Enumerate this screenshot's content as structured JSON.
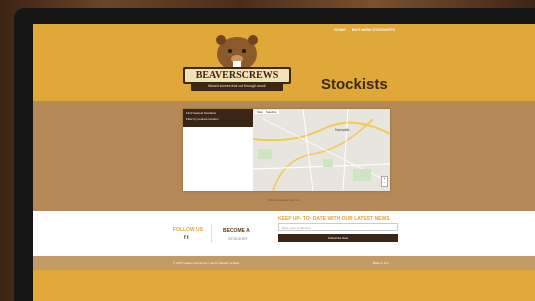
{
  "nav": {
    "home": "HOME",
    "buy": "BUY NOW STOCKISTS"
  },
  "logo": {
    "brand": "BEAVERSCREWS",
    "tagline": "Wizard screws that cut through wood!"
  },
  "page": {
    "title": "Stockists"
  },
  "locator": {
    "line1": "Find Nearest Stockists",
    "line2": "Filter by nearest location"
  },
  "map": {
    "tab1": "Map",
    "tab2": "Satellite",
    "city": "Norwalk",
    "zoom_in": "+",
    "zoom_out": "−"
  },
  "caption": "Show stockists near me",
  "footer": {
    "follow": "FOLLOW US",
    "social": "f  t",
    "become_line1": "BECOME A",
    "become_line2": "STOCKIST",
    "newsletter": "KEEP UP- TO- DATE WITH OUR LATEST NEWS",
    "email_placeholder": "Enter your email here",
    "subscribe": "Subscribe Now"
  },
  "bottom": {
    "copyright": "© 2017 beaver screws inc | site by Beaver screws",
    "back_to_top": "Back to Top"
  },
  "colors": {
    "primary": "#e0a739",
    "dark": "#3b2616",
    "band": "#b48955"
  }
}
